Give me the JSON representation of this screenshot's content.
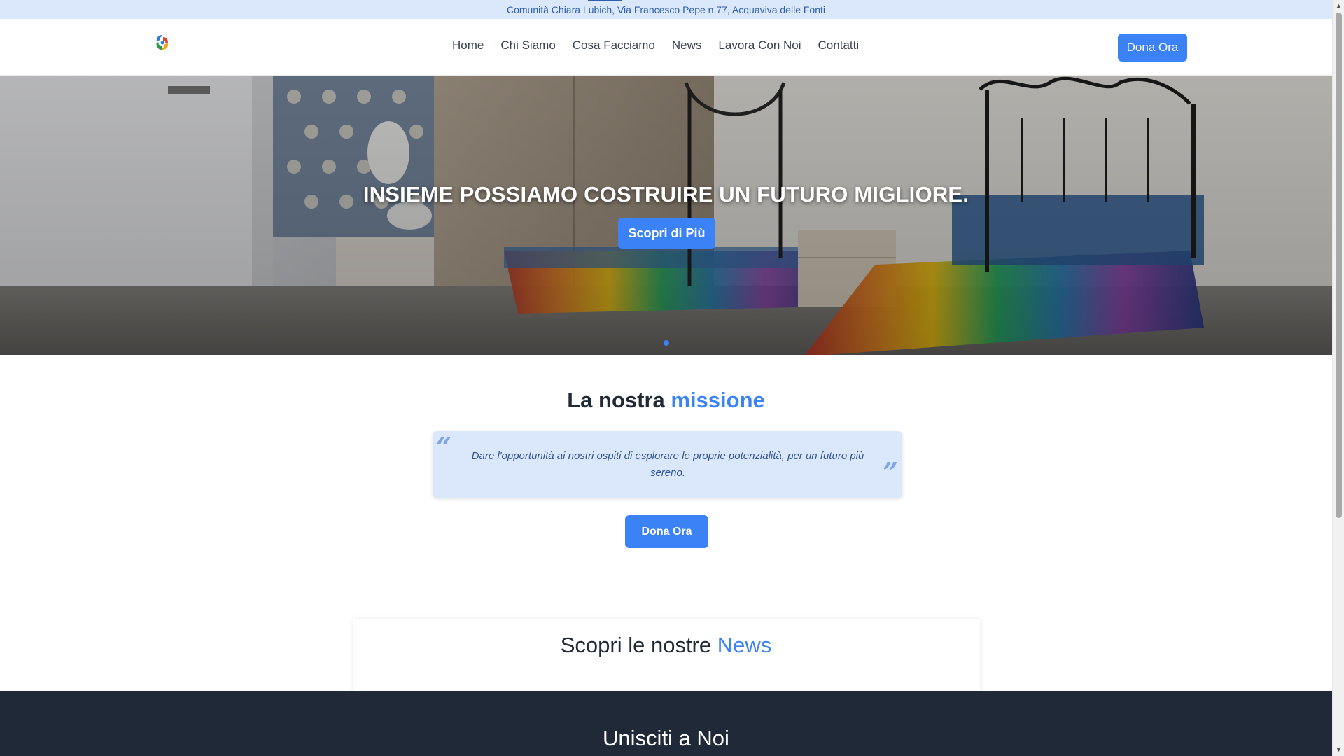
{
  "topbar": {
    "text": "Comunità Chiara Lubich, Via Francesco Pepe n.77, Acquaviva delle Fonti"
  },
  "header": {
    "nav": [
      "Home",
      "Chi Siamo",
      "Cosa Facciamo",
      "News",
      "Lavora Con Noi",
      "Contatti"
    ],
    "cta": "Dona Ora"
  },
  "hero": {
    "title": "INSIEME POSSIAMO COSTRUIRE UN FUTURO MIGLIORE.",
    "button": "Scopri di Più"
  },
  "mission": {
    "title_prefix": "La nostra",
    "title_accent": "missione",
    "quote": "Dare l'opportunità ai nostri ospiti di esplorare le proprie potenzialità, per un futuro più sereno.",
    "button": "Dona Ora"
  },
  "news": {
    "title_prefix": "Scopri le nostre",
    "title_accent": "News"
  },
  "join": {
    "title": "Unisciti a Noi"
  },
  "colors": {
    "accent": "#3b82f6",
    "dark": "#1f2937",
    "topbar": "#dbe8fb"
  }
}
